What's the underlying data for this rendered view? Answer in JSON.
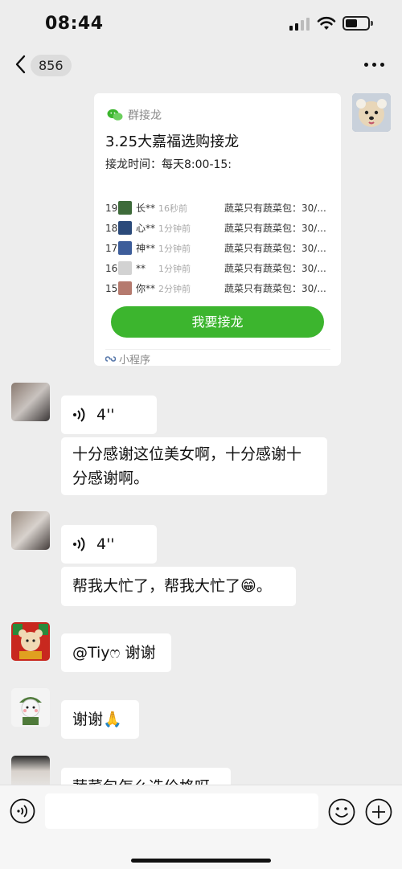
{
  "status": {
    "time": "08:44"
  },
  "nav": {
    "unread_count": "856"
  },
  "card": {
    "source": "群接龙",
    "title": "3.25大嘉福选购接龙",
    "subtitle": "接龙时间：每天8:00-15:",
    "rows": [
      {
        "num": "19",
        "name": "长**",
        "ago": "16秒前",
        "item": "蔬菜只有蔬菜包：30/...",
        "thumb_color": "#3e6b3a"
      },
      {
        "num": "18",
        "name": "心**",
        "ago": "1分钟前",
        "item": "蔬菜只有蔬菜包：30/...",
        "thumb_color": "#2b4a7a"
      },
      {
        "num": "17",
        "name": "神**",
        "ago": "1分钟前",
        "item": "蔬菜只有蔬菜包：30/...",
        "thumb_color": "#3d5d9a"
      },
      {
        "num": "16",
        "name": "**",
        "ago": "1分钟前",
        "item": "蔬菜只有蔬菜包：30/...",
        "thumb_color": "#c8c8c8"
      },
      {
        "num": "15",
        "name": "你**",
        "ago": "2分钟前",
        "item": "蔬菜只有蔬菜包：30/...",
        "thumb_color": "#b57a6e"
      }
    ],
    "button_label": "我要接龙",
    "footer": "小程序"
  },
  "messages": [
    {
      "type": "voice",
      "duration": "4''"
    },
    {
      "type": "text",
      "text_line1": "十分感谢这位美女啊，十分感谢十",
      "text_line2": "分感谢啊。"
    },
    {
      "type": "voice",
      "duration": "4''"
    },
    {
      "type": "text",
      "text_before": "帮我大忙了，帮我大忙了",
      "emoji": "😁",
      "text_after": "。"
    },
    {
      "type": "text",
      "text": "@Tiyෆ 谢谢"
    },
    {
      "type": "text",
      "text_before": "谢谢",
      "emoji": "🙏"
    },
    {
      "type": "text",
      "text": "蔬菜包怎么选价格呀"
    }
  ],
  "colors": {
    "accent": "#3cb52e",
    "background": "#ededed",
    "bubble": "#ffffff"
  }
}
